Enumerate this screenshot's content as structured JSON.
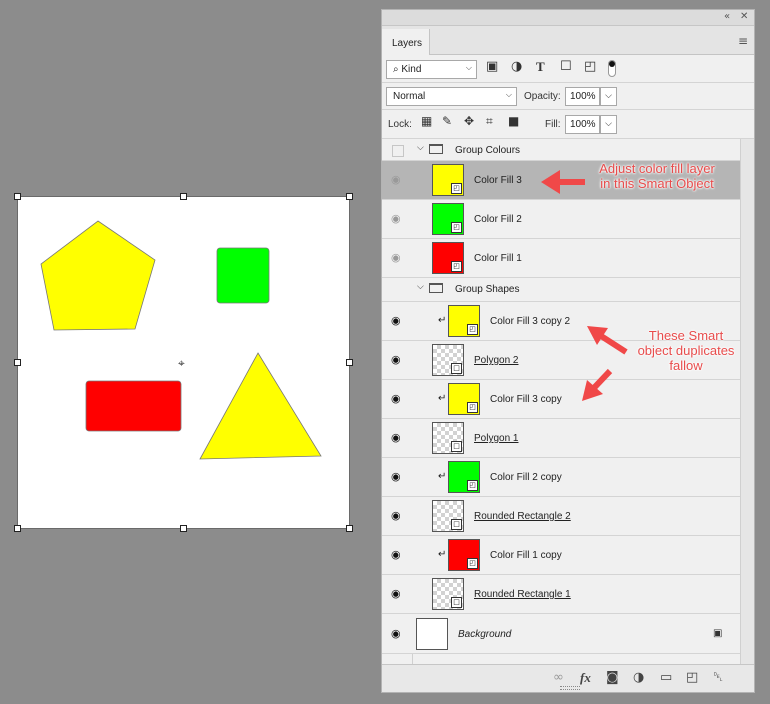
{
  "canvas": {
    "shapes": [
      {
        "name": "pentagon",
        "color": "#ffff00"
      },
      {
        "name": "green-square",
        "color": "#00ff00"
      },
      {
        "name": "red-rectangle",
        "color": "#ff0000"
      },
      {
        "name": "triangle",
        "color": "#ffff00"
      }
    ],
    "center_mark": "⌖"
  },
  "panel": {
    "collapse_icon": "«",
    "close_icon": "✕",
    "tab_label": "Layers",
    "menu_icon": "≡",
    "filter": {
      "kind_label": "Kind",
      "icons": [
        "image-filter-icon",
        "adjustment-filter-icon",
        "type-filter-icon",
        "shape-filter-icon",
        "smart-object-filter-icon"
      ]
    },
    "blend_mode": "Normal",
    "opacity_label": "Opacity:",
    "opacity_value": "100%",
    "lock_label": "Lock:",
    "fill_label": "Fill:",
    "fill_value": "100%"
  },
  "layers": [
    {
      "type": "group",
      "name": "Group Colours",
      "visible": false
    },
    {
      "type": "layer",
      "name": "Color Fill 3",
      "thumb_color": "#ffff00",
      "selected": true,
      "eye_dim": true
    },
    {
      "type": "layer",
      "name": "Color Fill 2",
      "thumb_color": "#00ff00",
      "eye_dim": true
    },
    {
      "type": "layer",
      "name": "Color Fill 1",
      "thumb_color": "#ff0000",
      "eye_dim": true
    },
    {
      "type": "group",
      "name": "Group Shapes",
      "visible": true
    },
    {
      "type": "layer",
      "name": "Color Fill 3 copy 2",
      "thumb_color": "#ffff00",
      "clipped": true
    },
    {
      "type": "layer",
      "name": "Polygon 2",
      "shape": true
    },
    {
      "type": "layer",
      "name": "Color Fill 3 copy",
      "thumb_color": "#ffff00",
      "clipped": true
    },
    {
      "type": "layer",
      "name": "Polygon 1",
      "shape": true
    },
    {
      "type": "layer",
      "name": "Color Fill 2 copy",
      "thumb_color": "#00ff00",
      "clipped": true
    },
    {
      "type": "layer",
      "name": "Rounded Rectangle 2",
      "shape": true
    },
    {
      "type": "layer",
      "name": "Color Fill 1 copy",
      "thumb_color": "#ff0000",
      "clipped": true
    },
    {
      "type": "layer",
      "name": "Rounded Rectangle 1",
      "shape": true
    },
    {
      "type": "background",
      "name": "Background"
    }
  ],
  "footer_icons": [
    "link-icon",
    "fx-icon",
    "mask-icon",
    "adjustment-icon",
    "folder-icon",
    "new-layer-icon",
    "trash-icon"
  ],
  "annotations": {
    "note1": "Adjust color fill layer in this Smart Object",
    "note2": "These Smart object duplicates fallow",
    "color": "#e84c4c"
  }
}
